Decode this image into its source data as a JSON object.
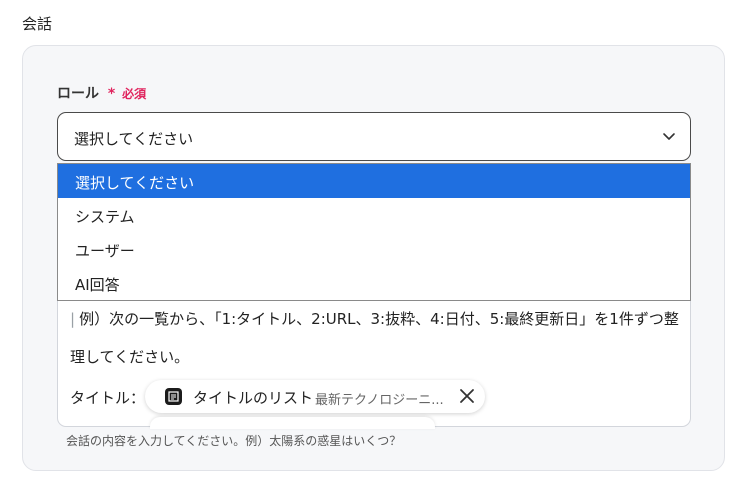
{
  "section": {
    "title": "会話"
  },
  "role_field": {
    "label": "ロール",
    "required_mark": "*",
    "required_text": "必須",
    "selected_value": "選択してください",
    "icon": "chevron-down-icon"
  },
  "dropdown": {
    "options": [
      "選択してください",
      "システム",
      "ユーザー",
      "AI回答"
    ],
    "selected_index": 0,
    "accent_color": "#1f6fe0"
  },
  "message_field": {
    "line1": "例）次の一覧から、「1:タイトル、2:URL、3:抜粋、4:日付、5:最終更新日」を1件ずつ整",
    "line2": "理してください。",
    "line3_label": "タイトル：",
    "chip": {
      "icon": "app-icon",
      "label": "タイトルのリスト",
      "sublabel": "最新テクノロジーニ...",
      "close_icon": "close-icon"
    },
    "helper": "会話の内容を入力してください。例）太陽系の惑星はいくつ？"
  }
}
